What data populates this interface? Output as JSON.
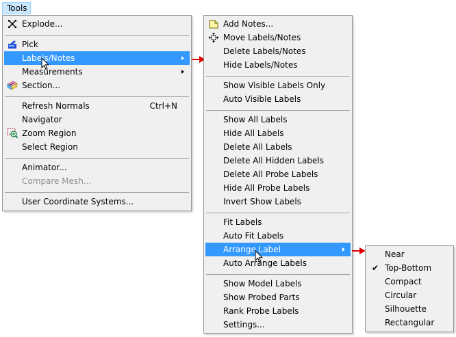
{
  "menubar": {
    "tools_label": "Tools"
  },
  "tools_menu": {
    "items": {
      "explode": "Explode...",
      "pick": "Pick",
      "labels_notes": "Labels/Notes",
      "measurements": "Measurements",
      "section": "Section...",
      "refresh_normals": "Refresh Normals",
      "refresh_normals_shortcut": "Ctrl+N",
      "navigator": "Navigator",
      "zoom_region": "Zoom Region",
      "select_region": "Select Region",
      "animator": "Animator...",
      "compare_mesh": "Compare Mesh...",
      "user_coordinate_systems": "User Coordinate Systems..."
    }
  },
  "labels_menu": {
    "items": {
      "add_notes": "Add Notes...",
      "move_labels_notes": "Move Labels/Notes",
      "delete_labels_notes": "Delete Labels/Notes",
      "hide_labels_notes": "Hide Labels/Notes",
      "show_visible_labels_only": "Show Visible Labels Only",
      "auto_visible_labels": "Auto Visible Labels",
      "show_all_labels": "Show All Labels",
      "hide_all_labels": "Hide All Labels",
      "delete_all_labels": "Delete All Labels",
      "delete_all_hidden_labels": "Delete All Hidden Labels",
      "delete_all_probe_labels": "Delete All Probe Labels",
      "hide_all_probe_labels": "Hide All Probe Labels",
      "invert_show_labels": "Invert Show Labels",
      "fit_labels": "Fit Labels",
      "auto_fit_labels": "Auto Fit Labels",
      "arrange_label": "Arrange Label",
      "auto_arrange_labels": "Auto Arrange Labels",
      "show_model_labels": "Show Model Labels",
      "show_probed_parts": "Show Probed Parts",
      "rank_probe_labels": "Rank Probe Labels",
      "settings": "Settings..."
    }
  },
  "arrange_menu": {
    "items": {
      "near": "Near",
      "top_bottom": "Top-Bottom",
      "compact": "Compact",
      "circular": "Circular",
      "silhouette": "Silhouette",
      "rectangular": "Rectangular"
    },
    "checked": "Top-Bottom"
  },
  "colors": {
    "highlight": "#3399ff",
    "menu_bg": "#f0f0f0",
    "disabled_text": "#8f8f8f",
    "pointer_arrow": "#e00000"
  },
  "icons": {
    "explode": "explode-icon",
    "pick": "pick-icon",
    "section": "section-icon",
    "zoom_region": "zoom-region-icon",
    "add_notes": "note-icon",
    "move_labels": "move-arrows-icon",
    "check": "checkmark-icon"
  }
}
